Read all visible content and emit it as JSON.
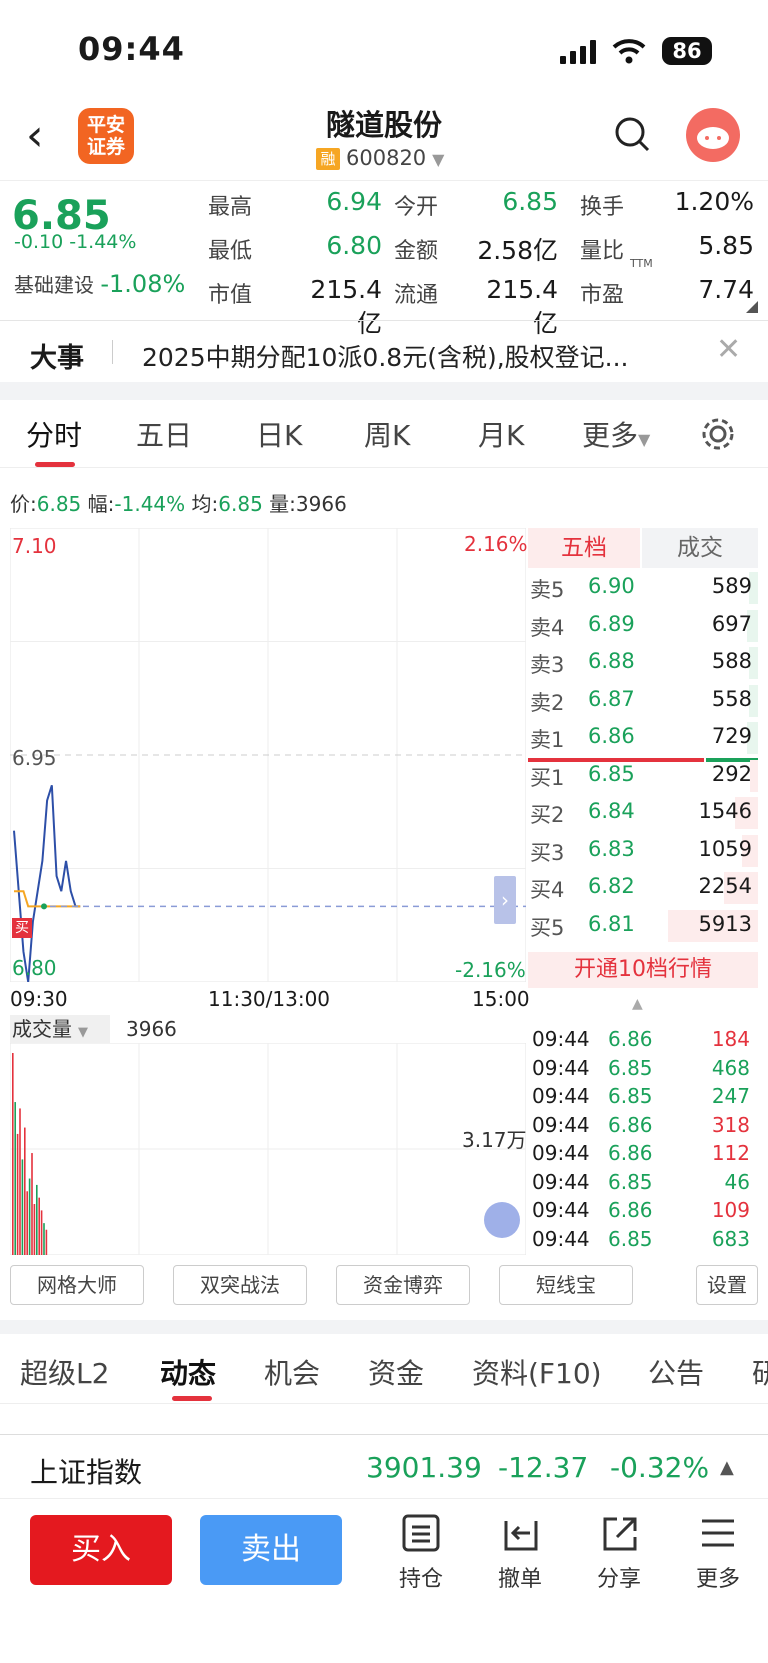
{
  "status": {
    "time": "09:44",
    "battery": "86"
  },
  "header": {
    "title": "隧道股份",
    "code": "600820",
    "rong": "融",
    "logo": "平安证券"
  },
  "quote": {
    "price": "6.85",
    "change": "-0.10",
    "pct": "-1.44%",
    "sector": "基础建设",
    "sector_pct": "-1.08%",
    "fields": [
      {
        "label": "最高",
        "value": "6.94",
        "color": "g"
      },
      {
        "label": "今开",
        "value": "6.85",
        "color": "g"
      },
      {
        "label": "换手",
        "value": "1.20%",
        "color": ""
      },
      {
        "label": "最低",
        "value": "6.80",
        "color": "g"
      },
      {
        "label": "金额",
        "value": "2.58亿",
        "color": ""
      },
      {
        "label": "量比",
        "value": "5.85",
        "color": ""
      },
      {
        "label": "市值",
        "value": "215.4亿",
        "color": ""
      },
      {
        "label": "流通",
        "value": "215.4亿",
        "color": ""
      },
      {
        "label": "市盈",
        "value": "7.74",
        "color": ""
      }
    ],
    "ttm": "TTM"
  },
  "news": {
    "tag": "大事",
    "text": "2025中期分配10派0.8元(含税),股权登记..."
  },
  "period_tabs": [
    "分时",
    "五日",
    "日K",
    "周K",
    "月K",
    "更多"
  ],
  "info_line": {
    "p_label": "价:",
    "p": "6.85",
    "f_label": "幅:",
    "f": "-1.44%",
    "a_label": "均:",
    "a": "6.85",
    "v_label": "量:",
    "v": "3966"
  },
  "chart": {
    "y_top": "7.10",
    "y_mid": "6.95",
    "y_bot": "6.80",
    "pct_top": "2.16%",
    "pct_bot": "-2.16%",
    "t_start": "09:30",
    "t_mid": "11:30/13:00",
    "t_end": "15:00",
    "buy_marker": "买",
    "vol_label": "成交量",
    "vol_value": "3966",
    "vol_max": "3.17万"
  },
  "chart_data": {
    "type": "line",
    "x": [
      "09:30",
      "09:31",
      "09:32",
      "09:33",
      "09:34",
      "09:35",
      "09:36",
      "09:37",
      "09:38",
      "09:39",
      "09:40",
      "09:41",
      "09:42",
      "09:43",
      "09:44"
    ],
    "series": [
      {
        "values": [
          6.9,
          6.86,
          6.82,
          6.8,
          6.84,
          6.86,
          6.88,
          6.92,
          6.93,
          6.87,
          6.86,
          6.88,
          6.86,
          6.85,
          6.85
        ]
      },
      {
        "values": [
          6.86,
          6.86,
          6.86,
          6.85,
          6.85,
          6.85,
          6.85,
          6.85,
          6.85,
          6.85,
          6.85,
          6.85,
          6.85,
          6.85,
          6.85
        ]
      }
    ],
    "ylim": [
      6.8,
      7.1
    ],
    "prev_close": 6.95,
    "volume": [
      31700,
      24000,
      19000,
      23000,
      15000,
      20000,
      10000,
      12000,
      16000,
      8000,
      11000,
      9000,
      7000,
      5000,
      3966
    ]
  },
  "orderbook": {
    "tab1": "五档",
    "tab2": "成交",
    "asks": [
      {
        "label": "卖5",
        "price": "6.90",
        "vol": "589",
        "w": 0.1
      },
      {
        "label": "卖4",
        "price": "6.89",
        "vol": "697",
        "w": 0.12
      },
      {
        "label": "卖3",
        "price": "6.88",
        "vol": "588",
        "w": 0.1
      },
      {
        "label": "卖2",
        "price": "6.87",
        "vol": "558",
        "w": 0.1
      },
      {
        "label": "卖1",
        "price": "6.86",
        "vol": "729",
        "w": 0.12
      }
    ],
    "bids": [
      {
        "label": "买1",
        "price": "6.85",
        "vol": "292",
        "w": 0.05
      },
      {
        "label": "买2",
        "price": "6.84",
        "vol": "1546",
        "w": 0.26
      },
      {
        "label": "买3",
        "price": "6.83",
        "vol": "1059",
        "w": 0.18
      },
      {
        "label": "买4",
        "price": "6.82",
        "vol": "2254",
        "w": 0.38
      },
      {
        "label": "买5",
        "price": "6.81",
        "vol": "5913",
        "w": 1
      }
    ],
    "open10": "开通10档行情"
  },
  "ticks": [
    {
      "t": "09:44",
      "p": "6.86",
      "v": "184",
      "c": "r"
    },
    {
      "t": "09:44",
      "p": "6.85",
      "v": "468",
      "c": "g"
    },
    {
      "t": "09:44",
      "p": "6.85",
      "v": "247",
      "c": "g"
    },
    {
      "t": "09:44",
      "p": "6.86",
      "v": "318",
      "c": "r"
    },
    {
      "t": "09:44",
      "p": "6.86",
      "v": "112",
      "c": "r"
    },
    {
      "t": "09:44",
      "p": "6.85",
      "v": "46",
      "c": "g"
    },
    {
      "t": "09:44",
      "p": "6.86",
      "v": "109",
      "c": "r"
    },
    {
      "t": "09:44",
      "p": "6.85",
      "v": "683",
      "c": "g"
    }
  ],
  "tools": [
    "网格大师",
    "双突战法",
    "资金博弈",
    "短线宝",
    "设置"
  ],
  "section_tabs": [
    "超级L2",
    "动态",
    "机会",
    "资金",
    "资料(F10)",
    "公告",
    "研"
  ],
  "index": {
    "name": "上证指数",
    "value": "3901.39",
    "change": "-12.37",
    "pct": "-0.32%"
  },
  "bottom": {
    "buy": "买入",
    "sell": "卖出",
    "icons": [
      "持仓",
      "撤单",
      "分享",
      "更多"
    ]
  }
}
